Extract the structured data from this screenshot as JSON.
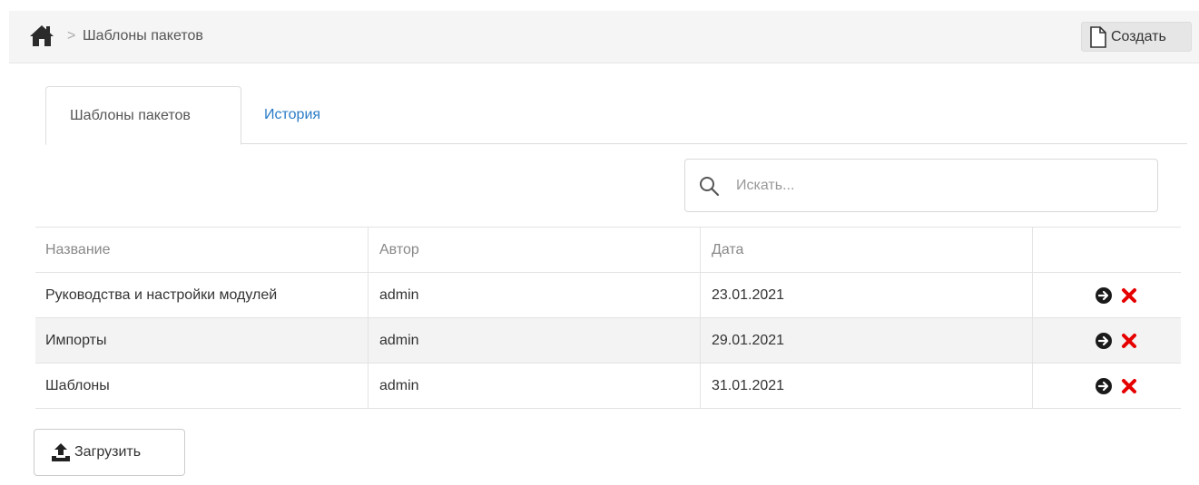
{
  "breadcrumb": {
    "home_icon": "home-icon",
    "separator": ">",
    "current": "Шаблоны пакетов"
  },
  "header": {
    "create_label": "Создать",
    "create_icon": "file-icon"
  },
  "tabs": [
    {
      "label": "Шаблоны пакетов",
      "active": true
    },
    {
      "label": "История",
      "active": false
    }
  ],
  "search": {
    "placeholder": "Искать...",
    "value": ""
  },
  "table": {
    "columns": [
      "Название",
      "Автор",
      "Дата",
      ""
    ],
    "rows": [
      {
        "name": "Руководства и настройки модулей",
        "author": "admin",
        "date": "23.01.2021"
      },
      {
        "name": "Импорты",
        "author": "admin",
        "date": "29.01.2021"
      },
      {
        "name": "Шаблоны",
        "author": "admin",
        "date": "31.01.2021"
      }
    ],
    "row_actions": [
      "arrow-circle-right-icon",
      "delete-x-icon"
    ]
  },
  "footer": {
    "upload_label": "Загрузить",
    "upload_icon": "upload-icon"
  },
  "colors": {
    "link": "#2a7cc7",
    "delete": "#e60000",
    "stripe": "#f3f3f3",
    "topbar": "#f5f5f5"
  }
}
